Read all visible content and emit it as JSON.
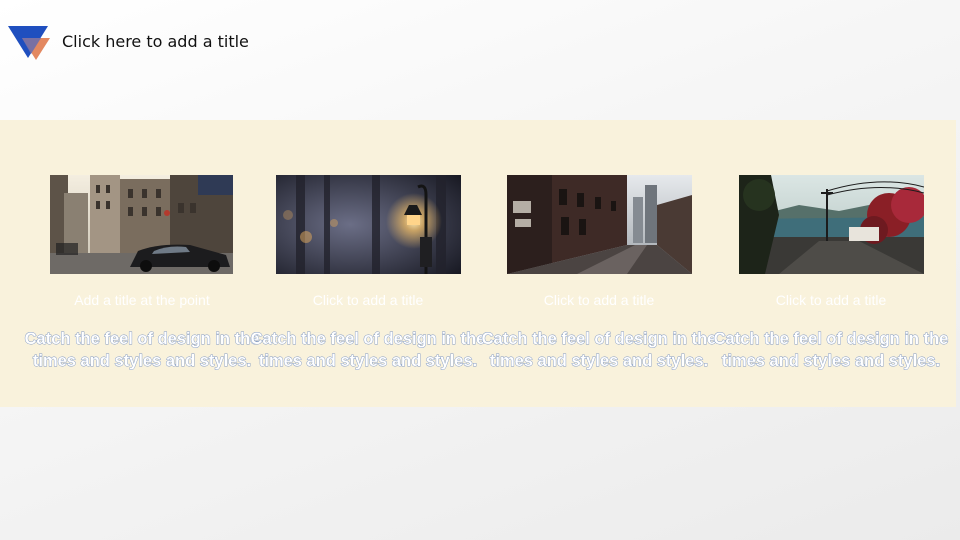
{
  "header": {
    "title": "Click here to add a title"
  },
  "cards": [
    {
      "title": "Add a title at the point",
      "body": "Catch the feel of design in the times and styles and styles.",
      "image_icon": "street-car-photo"
    },
    {
      "title": "Click to add a title",
      "body": "Catch the feel of design in the times and styles and styles.",
      "image_icon": "street-lamp-photo"
    },
    {
      "title": "Click to add a title",
      "body": "Catch the feel of design in the times and styles and styles.",
      "image_icon": "alley-photo"
    },
    {
      "title": "Click to add a title",
      "body": "Catch the feel of design in the times and styles and styles.",
      "image_icon": "harbor-photo"
    }
  ],
  "colors": {
    "band": "#f9f2dc",
    "logo_blue": "#1f4fbf",
    "logo_orange": "#e07b4f",
    "body_outline": "#7f97c2"
  }
}
